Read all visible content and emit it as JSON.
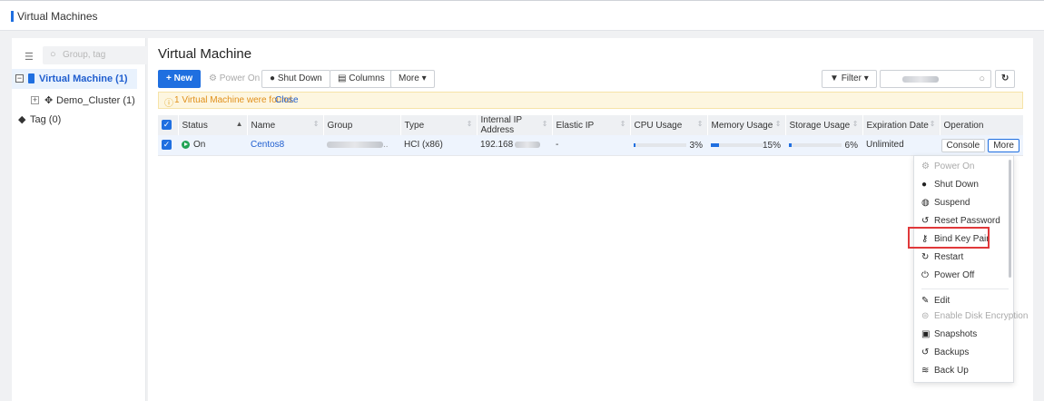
{
  "page": {
    "title": "Virtual Machines"
  },
  "sidebar": {
    "search_placeholder": "Group, tag",
    "tree": {
      "root": {
        "label": "Virtual Machine (1)",
        "expander": "−"
      },
      "cluster": {
        "label": "Demo_Cluster (1)",
        "expander": "+"
      },
      "tag": {
        "label": "Tag (0)"
      }
    }
  },
  "main": {
    "title": "Virtual Machine",
    "toolbar": {
      "new_label": "New",
      "power_on_label": "Power On",
      "shut_down_label": "Shut Down",
      "columns_label": "Columns",
      "more_label": "More",
      "filter_label": "Filter"
    },
    "notice": {
      "text": "1 Virtual Machine were found.",
      "close": "Close"
    },
    "table": {
      "headers": [
        "Status",
        "Name",
        "Group",
        "Type",
        "Internal IP Address",
        "Elastic IP",
        "CPU Usage",
        "Memory Usage",
        "Storage Usage",
        "Expiration Date",
        "Operation"
      ],
      "rows": [
        {
          "status": "On",
          "name": "Centos8",
          "group_suffix": "..",
          "type": "HCI (x86)",
          "ip": "192.168",
          "elastic_ip": "-",
          "cpu": "3%",
          "cpu_value": 0.03,
          "memory": "15%",
          "memory_value": 0.15,
          "storage": "6%",
          "storage_value": 0.06,
          "expiration": "Unlimited",
          "console_label": "Console",
          "more_label": "More"
        }
      ]
    }
  },
  "dropdown": {
    "items": [
      {
        "label": "Power On",
        "icon": "power-on-icon",
        "disabled": true
      },
      {
        "label": "Shut Down",
        "icon": "shut-down-icon",
        "disabled": false
      },
      {
        "label": "Suspend",
        "icon": "suspend-icon",
        "disabled": false
      },
      {
        "label": "Reset Password",
        "icon": "reset-password-icon",
        "disabled": false
      },
      {
        "label": "Bind Key Pair",
        "icon": "key-icon",
        "disabled": false,
        "highlighted": true
      },
      {
        "label": "Restart",
        "icon": "restart-icon",
        "disabled": false
      },
      {
        "label": "Power Off",
        "icon": "power-off-icon",
        "disabled": false
      },
      {
        "label": "Edit",
        "icon": "edit-icon",
        "disabled": false
      },
      {
        "label": "Enable Disk Encryption",
        "icon": "encryption-icon",
        "disabled": true
      },
      {
        "label": "Snapshots",
        "icon": "snapshot-icon",
        "disabled": false
      },
      {
        "label": "Backups",
        "icon": "backups-icon",
        "disabled": false
      },
      {
        "label": "Back Up",
        "icon": "back-up-icon",
        "disabled": false
      }
    ]
  },
  "colors": {
    "accent": "#1f6fe0",
    "highlight_border": "#e0383a",
    "status_on": "#22a355",
    "notice_bg": "#fdf6e0"
  }
}
